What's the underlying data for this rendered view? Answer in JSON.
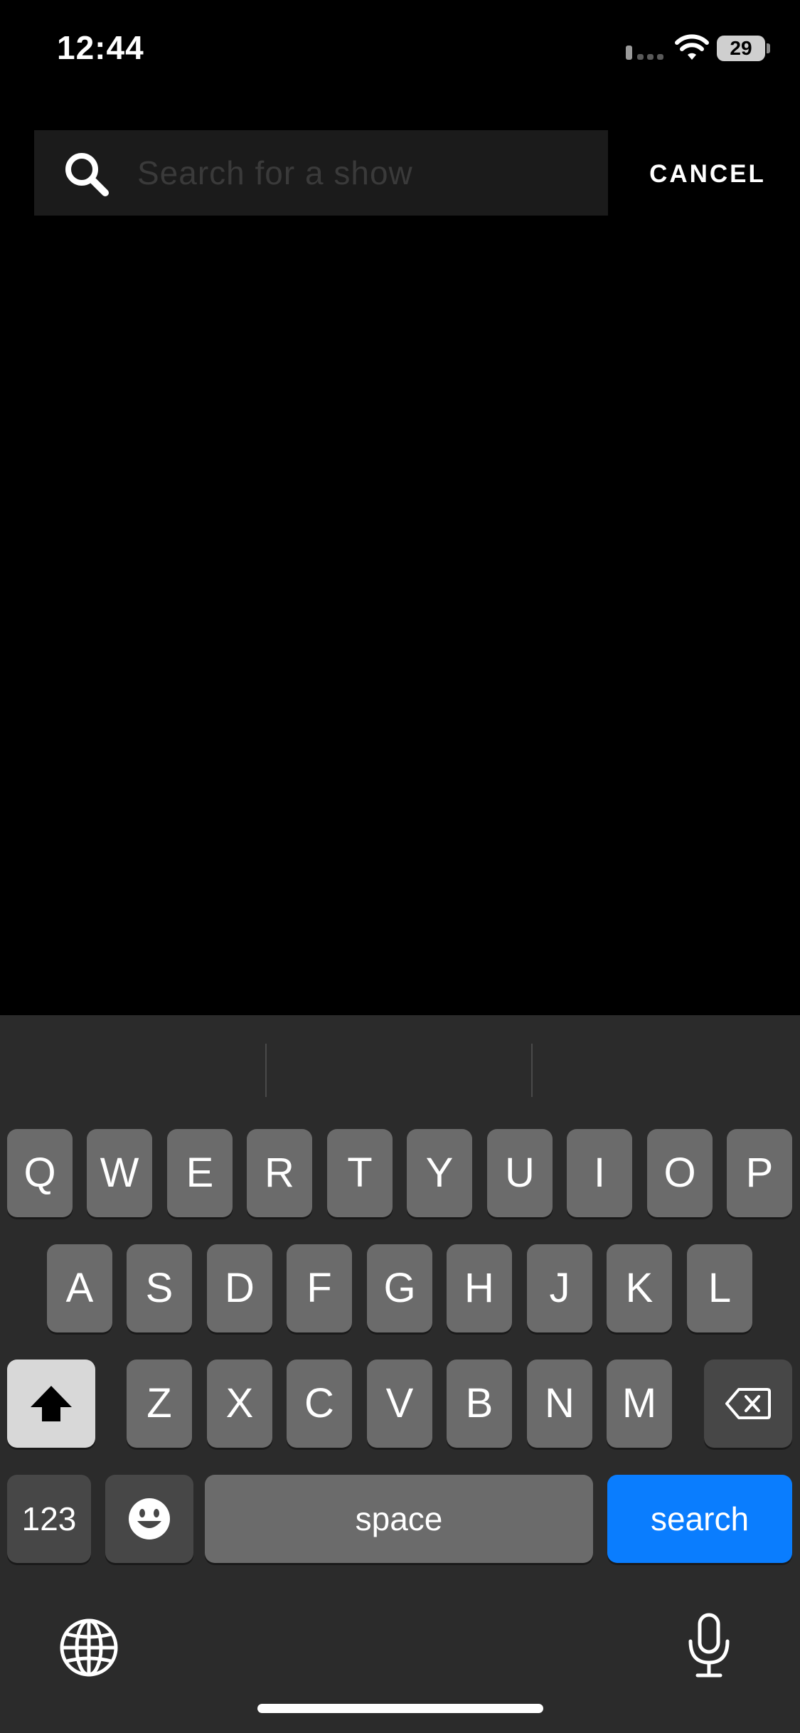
{
  "status_bar": {
    "time": "12:44",
    "battery": "29"
  },
  "search": {
    "placeholder": "Search for a show",
    "value": "",
    "cancel_label": "CANCEL"
  },
  "keyboard": {
    "row1": [
      "Q",
      "W",
      "E",
      "R",
      "T",
      "Y",
      "U",
      "I",
      "O",
      "P"
    ],
    "row2": [
      "A",
      "S",
      "D",
      "F",
      "G",
      "H",
      "J",
      "K",
      "L"
    ],
    "row3": [
      "Z",
      "X",
      "C",
      "V",
      "B",
      "N",
      "M"
    ],
    "numbers_label": "123",
    "space_label": "space",
    "return_label": "search",
    "icons": {
      "shift": "shift-arrow-icon",
      "delete": "backspace-icon",
      "emoji": "emoji-smiley-icon",
      "globe": "globe-icon",
      "mic": "microphone-icon"
    }
  },
  "colors": {
    "background": "#000000",
    "search_field": "#1b1b1b",
    "keyboard_bg": "#2b2b2b",
    "key": "#6b6b6b",
    "key_dark": "#474747",
    "return_key": "#0a7dfe"
  }
}
